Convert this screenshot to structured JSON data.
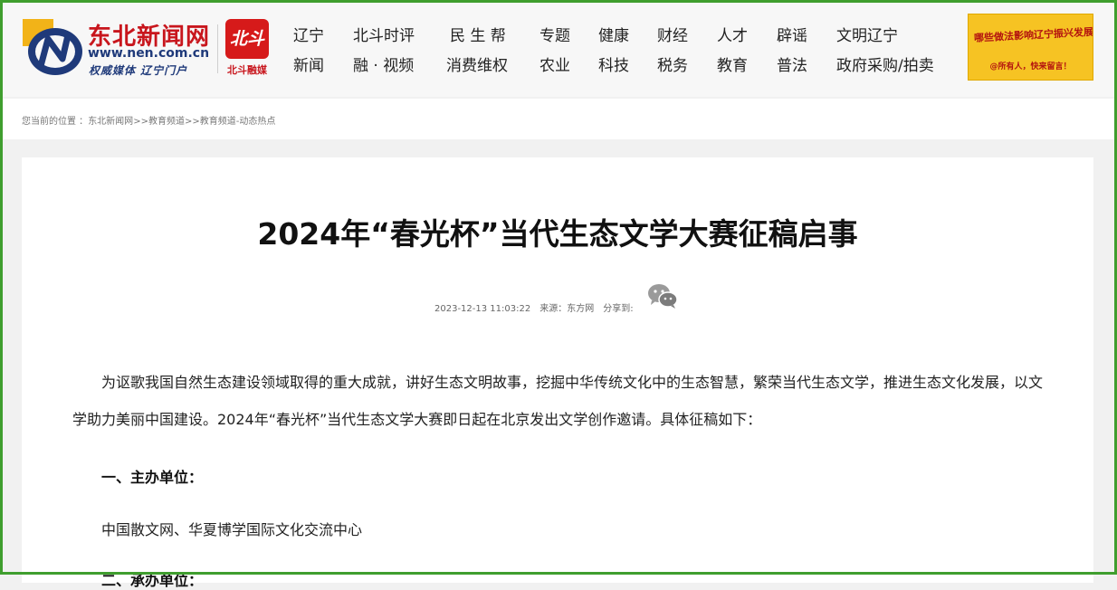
{
  "brand": {
    "name": "东北新闻网",
    "url": "www.nen.com.cn",
    "slogan": "权威媒体  辽宁门户",
    "partner_mark": "北斗",
    "partner_name": "北斗融媒"
  },
  "nav": {
    "row1": [
      "辽宁",
      "北斗时评",
      "民 生 帮",
      "专题",
      "健康",
      "财经",
      "人才",
      "辟谣",
      "文明辽宁"
    ],
    "row2": [
      "新闻",
      "融 · 视频",
      "消费维权",
      "农业",
      "科技",
      "税务",
      "教育",
      "普法",
      "政府采购/拍卖"
    ]
  },
  "ad": {
    "headline": "哪些做法影响辽宁振兴发展？",
    "tagline": "@所有人，快来留言！"
  },
  "breadcrumb": {
    "prefix": "您当前的位置 ：",
    "items": [
      "东北新闻网",
      "教育频道",
      "教育频道-动态热点"
    ],
    "separator": ">>"
  },
  "article": {
    "title": "2024年“春光杯”当代生态文学大赛征稿启事",
    "datetime": "2023-12-13 11:03:22",
    "source": "来源：东方网",
    "share_label": "分享到:",
    "intro": "为讴歌我国自然生态建设领域取得的重大成就，讲好生态文明故事，挖掘中华传统文化中的生态智慧，繁荣当代生态文学，推进生态文化发展，以文学助力美丽中国建设。2024年“春光杯”当代生态文学大赛即日起在北京发出文学创作邀请。具体征稿如下：",
    "section1_heading": "一、主办单位：",
    "section1_body": "中国散文网、华夏博学国际文化交流中心",
    "section2_heading": "二、承办单位："
  },
  "colors": {
    "frame_green": "#3f9e2e",
    "brand_red": "#c8161d",
    "brand_blue": "#1f3a7a",
    "ad_yellow": "#f6c323"
  },
  "icons": [
    "nen-logo-icon",
    "wechat-icon"
  ]
}
